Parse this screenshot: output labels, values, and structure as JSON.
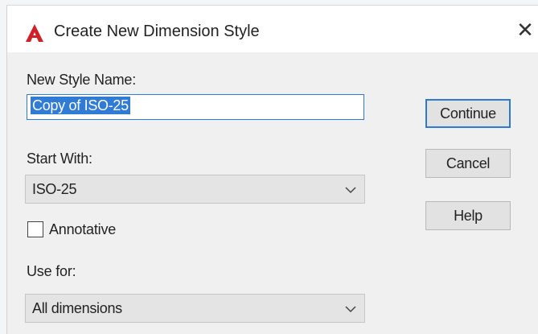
{
  "window": {
    "title": "Create New Dimension Style",
    "close_glyph": "✕",
    "logo_icon": "autocad-logo-icon",
    "accent_color": "#d12026"
  },
  "form": {
    "new_style_name_label": "New Style Name:",
    "new_style_name_value": "Copy of ISO-25",
    "start_with_label": "Start With:",
    "start_with_value": "ISO-25",
    "annotative_label": "Annotative",
    "annotative_checked": false,
    "use_for_label": "Use for:",
    "use_for_value": "All dimensions"
  },
  "buttons": {
    "continue": "Continue",
    "cancel": "Cancel",
    "help": "Help"
  }
}
